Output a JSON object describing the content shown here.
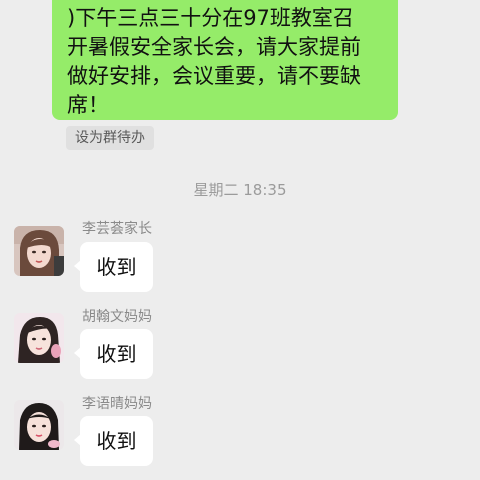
{
  "chat": {
    "top_message": {
      "lines": [
        ")下午三点三十分在97班教室召",
        "开暑假安全家长会，请大家提前",
        "做好安排，会议重要，请不要缺",
        "席！"
      ]
    },
    "group_todo_label": "设为群待办",
    "timestamp": "星期二 18:35",
    "messages": [
      {
        "sender": "李芸荟家长",
        "text": "收到"
      },
      {
        "sender": "胡翰文妈妈",
        "text": "收到"
      },
      {
        "sender": "李语晴妈妈",
        "text": "收到"
      }
    ]
  },
  "colors": {
    "background": "#ededed",
    "sent_bubble": "#95ec69",
    "received_bubble": "#ffffff"
  }
}
